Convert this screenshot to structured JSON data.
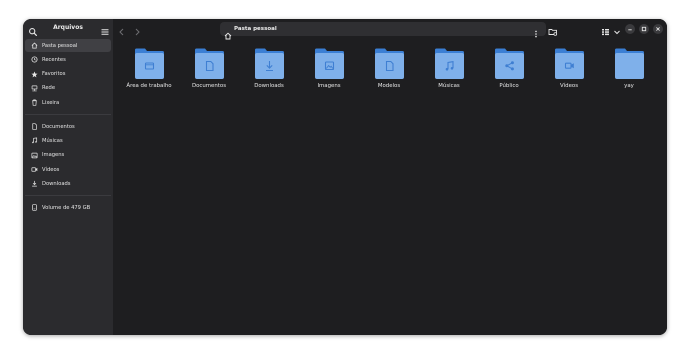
{
  "app": {
    "title": "Arquivos"
  },
  "sidebar": {
    "places": [
      {
        "label": "Pasta pessoal",
        "icon": "home-icon",
        "active": true
      },
      {
        "label": "Recentes",
        "icon": "clock-icon"
      },
      {
        "label": "Favoritos",
        "icon": "star-icon"
      },
      {
        "label": "Rede",
        "icon": "network-icon"
      },
      {
        "label": "Lixeira",
        "icon": "trash-icon"
      }
    ],
    "bookmarks": [
      {
        "label": "Documentos",
        "icon": "document-icon"
      },
      {
        "label": "Músicas",
        "icon": "music-icon"
      },
      {
        "label": "Imagens",
        "icon": "image-icon"
      },
      {
        "label": "Vídeos",
        "icon": "video-icon"
      },
      {
        "label": "Downloads",
        "icon": "download-icon"
      }
    ],
    "devices": [
      {
        "label": "Volume de 479 GB",
        "icon": "drive-icon"
      }
    ]
  },
  "pathbar": {
    "current": "Pasta pessoal"
  },
  "folders": [
    {
      "name": "Área de trabalho",
      "emblem": "desktop"
    },
    {
      "name": "Documentos",
      "emblem": "document"
    },
    {
      "name": "Downloads",
      "emblem": "download"
    },
    {
      "name": "Imagens",
      "emblem": "image"
    },
    {
      "name": "Modelos",
      "emblem": "template"
    },
    {
      "name": "Músicas",
      "emblem": "music"
    },
    {
      "name": "Público",
      "emblem": "share"
    },
    {
      "name": "Vídeos",
      "emblem": "video"
    },
    {
      "name": "yay",
      "emblem": ""
    }
  ],
  "colors": {
    "folder_back": "#3b7fd4",
    "folder_front": "#7fb0ea",
    "emblem": "#3f7fd2",
    "window_bg": "#1e1e20",
    "sidebar_bg": "#2b2b2e"
  }
}
